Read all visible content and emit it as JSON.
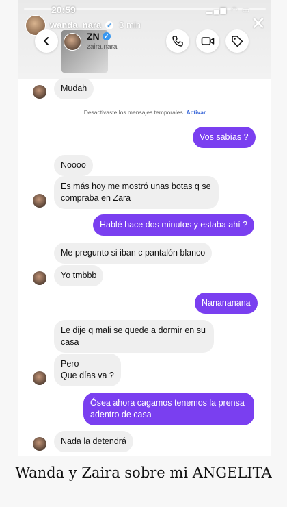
{
  "story": {
    "status_time": "20:59",
    "status_icons": "▂▄▆ ◠ ▭",
    "username": "wanda_nara",
    "elapsed": "3 min",
    "close_icon": "close-icon"
  },
  "chat_header": {
    "contact_name": "ZN",
    "contact_handle": "zaira.nara",
    "buttons": [
      "back-icon",
      "phone-icon",
      "video-icon",
      "tag-icon"
    ]
  },
  "notice": {
    "text": "Desactivaste los mensajes temporales.",
    "action": "Activar"
  },
  "messages": [
    {
      "side": "in",
      "text": "Mudah"
    },
    {
      "side": "out",
      "text": "Vos sabías ?"
    },
    {
      "side": "in",
      "text": "Noooo"
    },
    {
      "side": "in",
      "text": "Es más hoy me mostró unas botas q se compraba en Zara"
    },
    {
      "side": "out",
      "text": "Hablé hace dos minutos y estaba ahí ?"
    },
    {
      "side": "in",
      "text": "Me pregunto si iban c pantalón blanco"
    },
    {
      "side": "in",
      "text": "Yo tmbbb"
    },
    {
      "side": "out",
      "text": "Nanananana"
    },
    {
      "side": "in",
      "text": "Le dije q mali se quede a dormir en su casa"
    },
    {
      "side": "in",
      "text": "Pero\nQue días va ?"
    },
    {
      "side": "out",
      "text": "Ósea ahora cagamos tenemos la prensa adentro de casa"
    },
    {
      "side": "in",
      "text": "Nada la detendrá"
    }
  ],
  "caption": "Wanda y Zaira sobre mi ANGELITA",
  "colors": {
    "outgoing": "#7a3ff0",
    "incoming": "#efefef",
    "link": "#3a68d8"
  }
}
